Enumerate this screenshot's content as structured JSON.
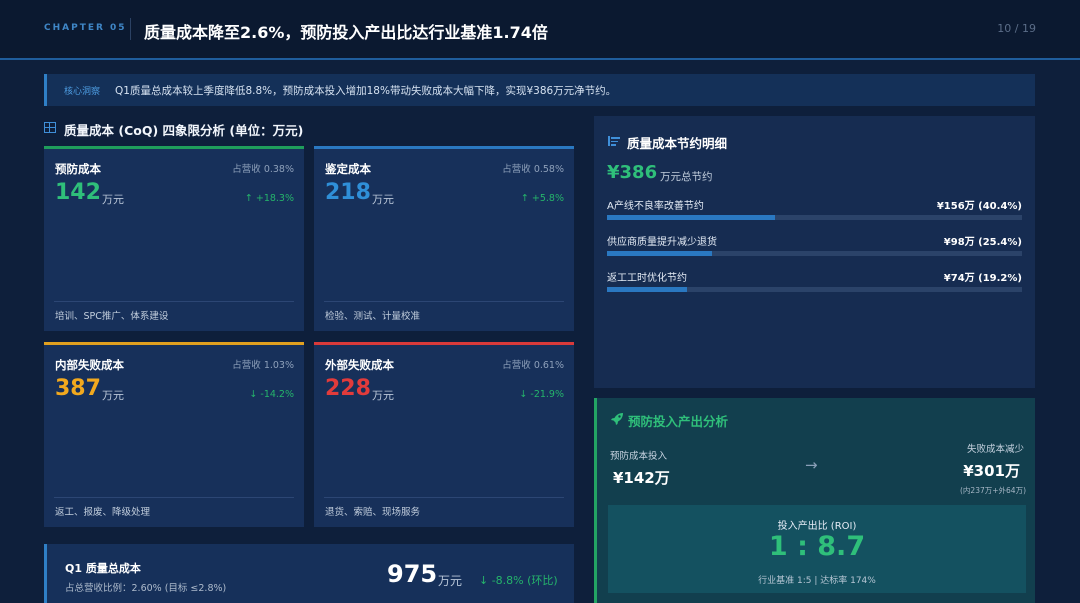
{
  "header": {
    "chapter": "CHAPTER 05",
    "title": "质量成本降至2.6%，预防投入产出比达行业基准1.74倍",
    "page": "10 / 19"
  },
  "insight": {
    "label": "核心洞察",
    "text": "Q1质量总成本较上季度降低8.8%，预防成本投入增加18%带动失败成本大幅下降，实现¥386万元净节约。"
  },
  "coq": {
    "title": "质量成本 (CoQ) 四象限分析 (单位：万元)",
    "cards": [
      {
        "name": "预防成本",
        "share": "占营收 0.38%",
        "value": "142",
        "unit": "万元",
        "trend": "↑ +18.3%",
        "desc": "培训、SPC推广、体系建设",
        "accent": "#1f9d5b",
        "value_color": "#2fbf7a"
      },
      {
        "name": "鉴定成本",
        "share": "占营收 0.58%",
        "value": "218",
        "unit": "万元",
        "trend": "↑ +5.8%",
        "desc": "检验、测试、计量校准",
        "accent": "#2a78c1",
        "value_color": "#2f8fd8"
      },
      {
        "name": "内部失败成本",
        "share": "占营收 1.03%",
        "value": "387",
        "unit": "万元",
        "trend": "↓ -14.2%",
        "desc": "返工、报废、降级处理",
        "accent": "#e0a020",
        "value_color": "#f2a91e"
      },
      {
        "name": "外部失败成本",
        "share": "占营收 0.61%",
        "value": "228",
        "unit": "万元",
        "trend": "↓ -21.9%",
        "desc": "退货、索赔、现场服务",
        "accent": "#d93a3a",
        "value_color": "#e23b3b"
      }
    ]
  },
  "total": {
    "name": "Q1 质量总成本",
    "sub": "占总营收比例：2.60% (目标 ≤2.8%)",
    "value": "975",
    "unit": "万元",
    "trend": "↓ -8.8% (环比)"
  },
  "savings": {
    "title": "质量成本节约明细",
    "big_value": "¥386",
    "big_unit": "万元总节约",
    "items": [
      {
        "label": "A产线不良率改善节约",
        "amount": "¥156万 (40.4%)",
        "pct": 40.4
      },
      {
        "label": "供应商质量提升减少退货",
        "amount": "¥98万 (25.4%)",
        "pct": 25.4
      },
      {
        "label": "返工工时优化节约",
        "amount": "¥74万 (19.2%)",
        "pct": 19.2
      }
    ]
  },
  "roi": {
    "title": "预防投入产出分析",
    "left_label": "预防成本投入",
    "left_value": "¥142万",
    "arrow": "→",
    "right_label": "失败成本减少",
    "right_value": "¥301万",
    "right_note": "(内237万+外64万)",
    "box_label": "投入产出比 (ROI)",
    "box_value": "1 : 8.7",
    "box_sub": "行业基准 1:5 | 达标率 174%"
  }
}
